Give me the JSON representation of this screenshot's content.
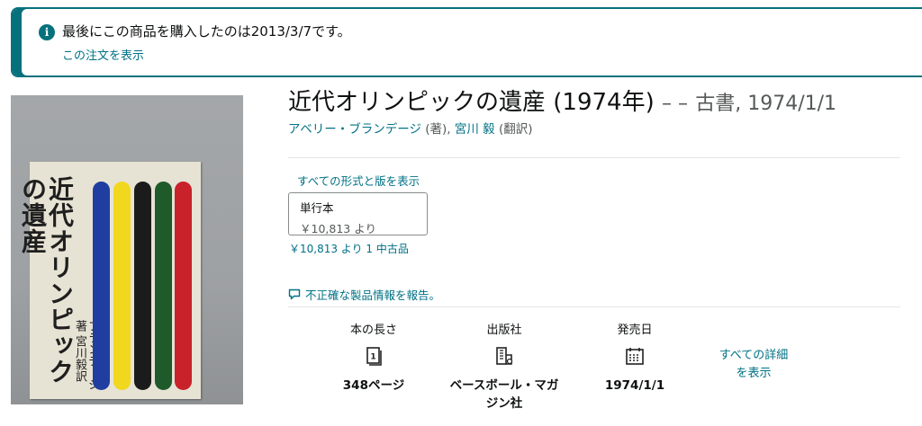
{
  "notice": {
    "message": "最後にこの商品を購入したのは2013/3/7です。",
    "order_link": "この注文を表示"
  },
  "cover": {
    "title_vertical": "近代オリンピックの遺産",
    "author_vertical": "ブランデージ著 宮川毅訳",
    "stripe_colors": [
      "#1f3ea0",
      "#f1d81e",
      "#1b1b1b",
      "#1f5a2a",
      "#c8222a"
    ]
  },
  "product": {
    "title": "近代オリンピックの遺産 (1974年)",
    "separator": "– –",
    "meta": "古書, 1974/1/1",
    "author1": "アベリー・ブランデージ",
    "author1_role": "(著),",
    "author2": "宮川 毅",
    "author2_role": "(翻訳)"
  },
  "formats": {
    "all_link": "すべての形式と版を表示",
    "format_name": "単行本",
    "format_price": "￥10,813 より",
    "used_price": "￥10,813 より",
    "used_count": "1 中古品"
  },
  "report_link": "不正確な製品情報を報告。",
  "details": [
    {
      "label": "本の長さ",
      "icon": "book-pages-icon",
      "value": "348ページ"
    },
    {
      "label": "出版社",
      "icon": "building-icon",
      "value": "ベースボール・マガジン社"
    },
    {
      "label": "発売日",
      "icon": "calendar-icon",
      "value": "1974/1/1"
    }
  ],
  "details_all_link": "すべての詳細を表示",
  "colors": {
    "link": "#007185",
    "notice_border": "#06717c"
  }
}
